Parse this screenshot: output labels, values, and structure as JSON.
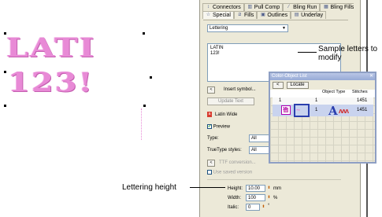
{
  "canvas": {
    "line1": "LATI",
    "line2": "123!"
  },
  "tabs_row1": [
    {
      "label": "Connectors",
      "icon": "connectors-icon"
    },
    {
      "label": "Pull Comp",
      "icon": "pull-comp-icon"
    },
    {
      "label": "Bling Run",
      "icon": "bling-run-icon"
    },
    {
      "label": "Bling Fills",
      "icon": "bling-fills-icon"
    }
  ],
  "tabs_row2": [
    {
      "label": "Special",
      "icon": "special-icon",
      "active": true
    },
    {
      "label": "Fills",
      "icon": "fills-icon"
    },
    {
      "label": "Outlines",
      "icon": "outlines-icon"
    },
    {
      "label": "Underlay",
      "icon": "underlay-icon"
    }
  ],
  "object_properties": {
    "object_type": "Lettering",
    "text": "LATIN\n123!",
    "insert_symbol": "Insert symbol...",
    "update_text": "Update Text",
    "font": "Latin Wide",
    "preview_label": "Preview",
    "type_label": "Type:",
    "type_value": "All",
    "truetype_label": "TrueType styles:",
    "truetype_value": "All",
    "ttf_conversion": "TTF conversion...",
    "use_saved_version": "Use saved version",
    "height_label": "Height:",
    "height_value": "10.00",
    "height_unit": "mm",
    "width_label": "Width:",
    "width_value": "100",
    "width_unit": "%",
    "italic_label": "Italic:",
    "italic_value": "0",
    "italic_unit": "°"
  },
  "color_object_list": {
    "title": "Color-Object List",
    "locate_button": "Locate",
    "columns": [
      "Object Type",
      "Stitches"
    ],
    "row1": {
      "index": "1",
      "count": "1",
      "stitches": "1451"
    },
    "row2": {
      "swatch_number": "15",
      "count": "1",
      "stitches": "1451"
    }
  },
  "callouts": {
    "sample_letters": "Sample letters to\nmodify",
    "lettering_height": "Lettering height"
  },
  "colors": {
    "stitch_pink": "#e88ad6",
    "selection_blue": "#2b3fae",
    "panel_bg": "#ece9d8"
  }
}
